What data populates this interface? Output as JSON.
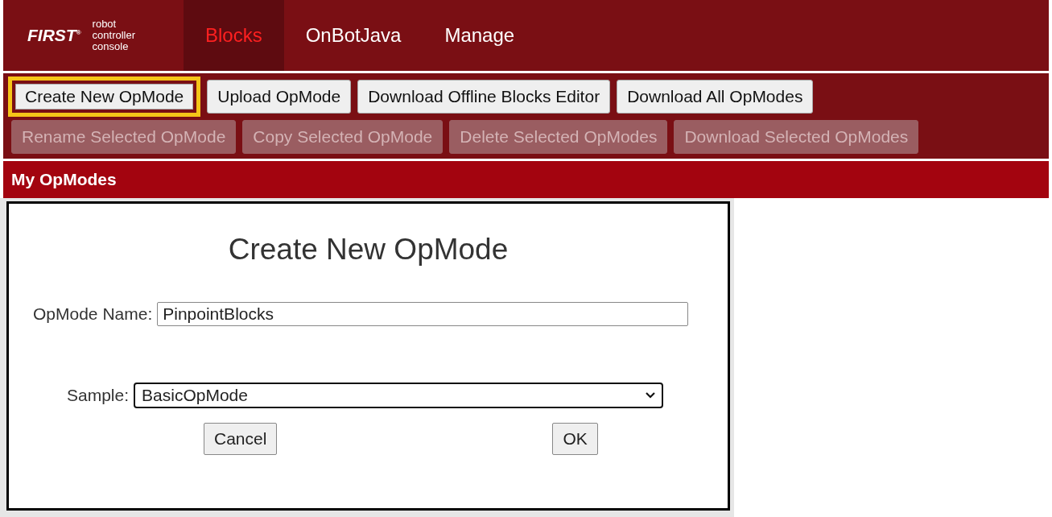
{
  "header": {
    "logo": "FIRST",
    "logo_mark": "®",
    "subtitle": [
      "robot",
      "controller",
      "console"
    ],
    "tabs": [
      {
        "label": "Blocks",
        "selected": true
      },
      {
        "label": "OnBotJava",
        "selected": false
      },
      {
        "label": "Manage",
        "selected": false
      }
    ]
  },
  "toolbar": {
    "rows": [
      [
        {
          "label": "Create New OpMode",
          "disabled": false,
          "highlighted": true
        },
        {
          "label": "Upload OpMode",
          "disabled": false,
          "highlighted": false
        },
        {
          "label": "Download Offline Blocks Editor",
          "disabled": false,
          "highlighted": false
        },
        {
          "label": "Download All OpModes",
          "disabled": false,
          "highlighted": false
        }
      ],
      [
        {
          "label": "Rename Selected OpMode",
          "disabled": true,
          "highlighted": false
        },
        {
          "label": "Copy Selected OpMode",
          "disabled": true,
          "highlighted": false
        },
        {
          "label": "Delete Selected OpModes",
          "disabled": true,
          "highlighted": false
        },
        {
          "label": "Download Selected OpModes",
          "disabled": true,
          "highlighted": false
        }
      ]
    ]
  },
  "section_title": "My OpModes",
  "dialog": {
    "title": "Create New OpMode",
    "name_label": "OpMode Name:",
    "name_value": "PinpointBlocks",
    "sample_label": "Sample:",
    "sample_value": "BasicOpMode",
    "buttons": [
      "Cancel",
      "OK"
    ]
  }
}
